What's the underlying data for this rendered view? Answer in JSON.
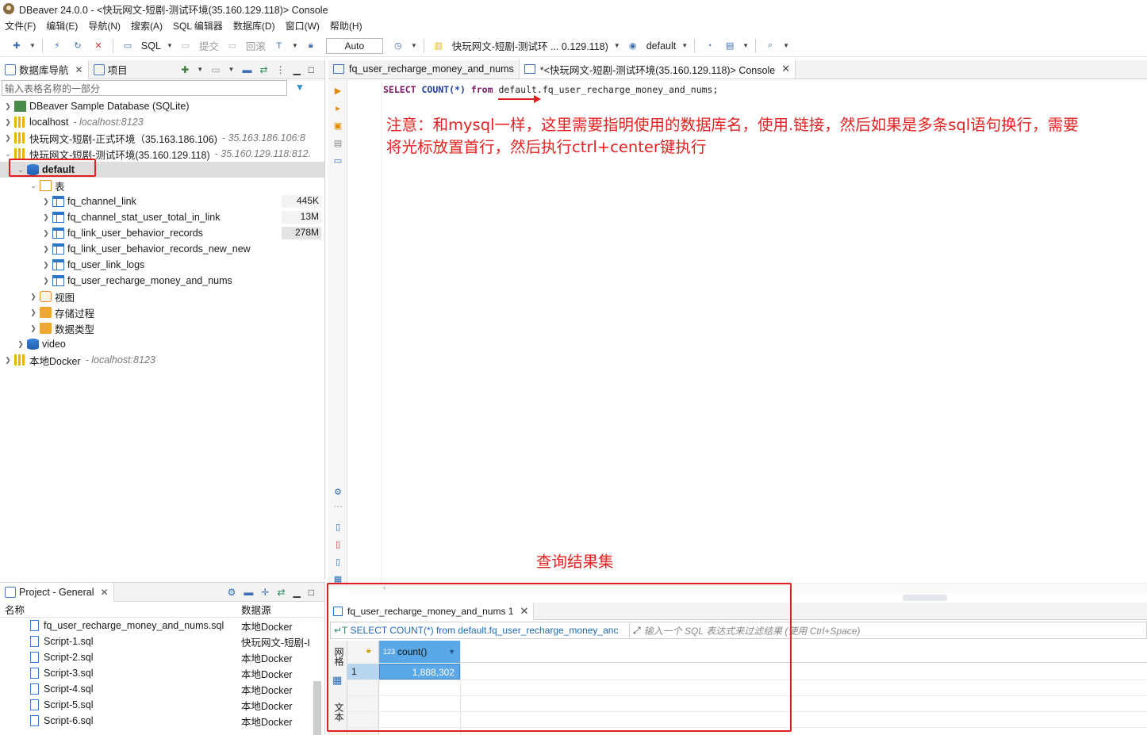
{
  "window": {
    "title": "DBeaver 24.0.0 - <快玩网文-短剧-测试环境(35.160.129.118)> Console"
  },
  "menu": [
    "文件(F)",
    "编辑(E)",
    "导航(N)",
    "搜索(A)",
    "SQL 编辑器",
    "数据库(D)",
    "窗口(W)",
    "帮助(H)"
  ],
  "toolbar": {
    "sql_label": "SQL",
    "commit_label": "提交",
    "rollback_label": "回滚",
    "transaction_mode": "Auto",
    "datasource_label": "快玩网文-短剧-测试环 ... 0.129.118)",
    "schema_label": "default"
  },
  "navigator": {
    "tab_db": "数据库导航",
    "tab_project": "项目",
    "filter_placeholder": "输入表格名称的一部分",
    "tree": [
      {
        "label": "DBeaver Sample Database (SQLite)",
        "sub": "",
        "size": ""
      },
      {
        "label": "localhost",
        "sub": "- localhost:8123",
        "size": ""
      },
      {
        "label": "快玩网文-短剧-正式环境（35.163.186.106)",
        "sub": "- 35.163.186.106:8",
        "size": ""
      },
      {
        "label": "快玩网文-短剧-测试环境(35.160.129.118)",
        "sub": "- 35.160.129.118:812.",
        "size": ""
      },
      {
        "label": "default",
        "sub": "",
        "size": ""
      },
      {
        "label": "表",
        "sub": "",
        "size": ""
      },
      {
        "label": "fq_channel_link",
        "sub": "",
        "size": "445K"
      },
      {
        "label": "fq_channel_stat_user_total_in_link",
        "sub": "",
        "size": "13M"
      },
      {
        "label": "fq_link_user_behavior_records",
        "sub": "",
        "size": "278M"
      },
      {
        "label": "fq_link_user_behavior_records_new_new",
        "sub": "",
        "size": ""
      },
      {
        "label": "fq_user_link_logs",
        "sub": "",
        "size": ""
      },
      {
        "label": "fq_user_recharge_money_and_nums",
        "sub": "",
        "size": ""
      },
      {
        "label": "视图",
        "sub": "",
        "size": ""
      },
      {
        "label": "存储过程",
        "sub": "",
        "size": ""
      },
      {
        "label": "数据类型",
        "sub": "",
        "size": ""
      },
      {
        "label": "video",
        "sub": "",
        "size": ""
      },
      {
        "label": "本地Docker",
        "sub": "- localhost:8123",
        "size": ""
      }
    ]
  },
  "project": {
    "title": "Project - General",
    "col_name": "名称",
    "col_source": "数据源",
    "rows": [
      {
        "name": "fq_user_recharge_money_and_nums.sql",
        "source": "本地Docker"
      },
      {
        "name": "Script-1.sql",
        "source": "快玩网文-短剧-I"
      },
      {
        "name": "Script-2.sql",
        "source": "本地Docker"
      },
      {
        "name": "Script-3.sql",
        "source": "本地Docker"
      },
      {
        "name": "Script-4.sql",
        "source": "本地Docker"
      },
      {
        "name": "Script-5.sql",
        "source": "本地Docker"
      },
      {
        "name": "Script-6.sql",
        "source": "本地Docker"
      }
    ]
  },
  "editor": {
    "tab1": "fq_user_recharge_money_and_nums",
    "tab2": "*<快玩网文-短剧-测试环境(35.160.129.118)> Console",
    "sql": {
      "select": "SELECT",
      "count": "COUNT(*)",
      "from": "from",
      "table": "default.fq_user_recharge_money_and_nums;"
    },
    "note_line1": "注意：和mysql一样，这里需要指明使用的数据库名，使用.链接，然后如果是多条sql语句换行，需要",
    "note_line2": "将光标放置首行，然后执行ctrl+center键执行",
    "result_note": "查询结果集"
  },
  "results": {
    "tab_label": "fq_user_recharge_money_and_nums 1",
    "query_text": "SELECT COUNT(*) from default.fq_user_recharge_money_anc",
    "filter_hint": "输入一个 SQL 表达式来过滤结果 (使用 Ctrl+Space)",
    "side_grid": "网格",
    "side_text": "文本",
    "column_type": "123",
    "column_name": "count()",
    "row_num": "1",
    "value": "1,888,302"
  }
}
